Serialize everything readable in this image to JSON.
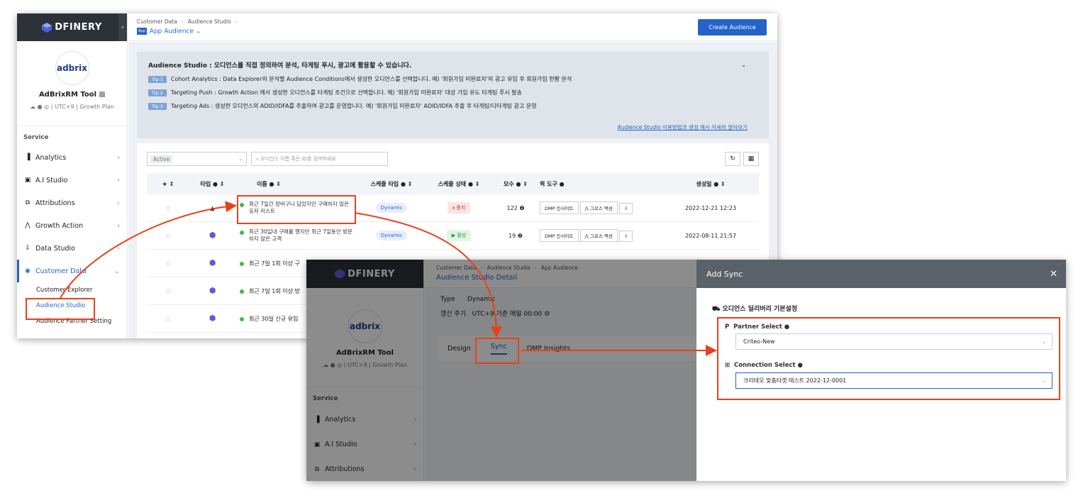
{
  "s1": {
    "logo": "DFINERY",
    "app_name": "AdBrixRM Tool",
    "avatar": "adbrix",
    "meta": "☁ ● ◎ | UTC+9 | Growth Plan",
    "service_label": "Service",
    "menu": [
      {
        "label": "Analytics",
        "icon": "▐"
      },
      {
        "label": "A.I Studio",
        "icon": "▣"
      },
      {
        "label": "Attributions",
        "icon": "⧉"
      },
      {
        "label": "Growth Action",
        "icon": "⋀"
      },
      {
        "label": "Data Studio",
        "icon": "⇩"
      },
      {
        "label": "Customer Data",
        "icon": "◉"
      }
    ],
    "submenu": [
      "Customer Explorer",
      "Audience Studio",
      "Audience Partner Setting"
    ],
    "breadcrumb": [
      "Customer Data",
      "Audience Studio"
    ],
    "title": "App Audience",
    "app_badge": "App",
    "create_btn": "Create Audience",
    "info_title": "Audience Studio : 오디언스를 직접 정의하여 분석, 타게팅 푸시, 광고에 활용할 수 있습니다.",
    "tips": [
      {
        "tag": "Tip 1",
        "text": "Cohort Analytics : Data Explorer의 분석별 Audience Conditions에서 생성한 오디언스를 선택합니다. 예) '회원가입 미완료자'의 광고 유입 후 회원가입 현황 분석"
      },
      {
        "tag": "Tip 2",
        "text": "Targeting Push : Growth Action 에서 생성한 오디언스를 타게팅 조건으로 선택합니다. 예) '회원가입 미완료자' 대상 가입 유도 타게팅 푸시 발송"
      },
      {
        "tag": "Tip 3",
        "text": "Targeting Ads : 생성한 오디언스의 ADID/IDFA를 추출하여 광고를 운영합니다. 예) '회원가입 미완료자' ADID/IDFA 추출 후 타게팅/디타게팅 광고 운영"
      }
    ],
    "info_link": "Audience Studio 이용방법과 생성 예시 자세히 알아보기",
    "filter": "Active",
    "search_placeholder": "오디언스 이름 혹은 ID를 검색하세요",
    "headers": [
      "★ ⇕",
      "타입 ● ⇕",
      "이름 ● ⇕",
      "스케쥴 타입 ● ⇕",
      "스케쥴 상태 ● ⇕",
      "모수 ● ⇕",
      "퀵 도구 ●",
      "생성일 ● ⇕"
    ],
    "rows": [
      {
        "name": "최근 7일간 장바구니 담았지만 구매하지 않은 유저 리스트",
        "schedule": "Dynamic",
        "status": "⏸ 중지",
        "status_type": "stop",
        "count": "122 ❷",
        "date": "2022-12-21 12:23",
        "type": "person"
      },
      {
        "name": "최근 30일내 구매를 했지만 최근 7일동안 방문하지 않은 고객",
        "schedule": "Dynamic",
        "status": "▶ 활성",
        "status_type": "run",
        "count": "19 ❷",
        "date": "2022-08-11 21:57",
        "type": "hex"
      },
      {
        "name": "최근 7일 1회 이상 구",
        "type": "hex"
      },
      {
        "name": "최근 7일 1회 이상 방",
        "type": "hex"
      },
      {
        "name": "최근 30일 신규 유입",
        "type": "hex"
      }
    ],
    "tools": [
      "DMP 인사이트",
      "⋀ 그로스 액션",
      "⇩"
    ]
  },
  "s2": {
    "breadcrumb": [
      "Customer Data",
      "Audience Studio",
      "App Audience"
    ],
    "title": "Audience Studio Detail",
    "type_label": "Type",
    "type_value": "Dynamic",
    "cycle_label": "갱신 주기",
    "cycle_value": "UTC+9 기준 매일 00:00",
    "tabs": [
      "Design",
      "Sync",
      "DMP Insights"
    ],
    "menu": [
      "Analytics",
      "A.I Studio",
      "Attributions"
    ],
    "panel_title": "Add Sync",
    "section": "오디언스 딜리버리 기본설정",
    "partner_label": "Partner Select",
    "partner_value": "Criteo-New",
    "conn_label": "Connection Select",
    "conn_value": "크리테오 맞춤타겟 테스트 2022-12-0001"
  },
  "colors": {
    "accent": "#2563c9",
    "annot": "#e8401c"
  }
}
